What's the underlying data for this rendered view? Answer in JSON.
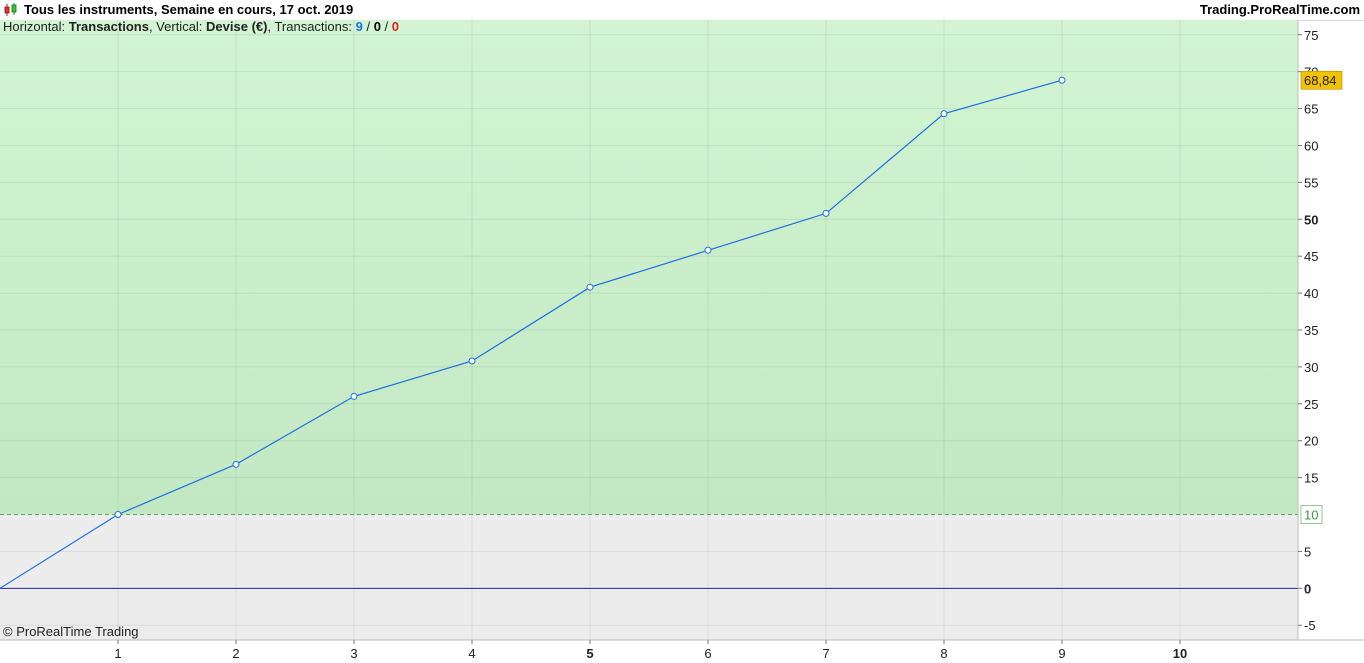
{
  "header": {
    "title": "Tous les instruments, Semaine en cours, 17 oct. 2019",
    "brand": "Trading.ProRealTime.com"
  },
  "legend": {
    "horizontal_label": "Horizontal: ",
    "horizontal_value": "Transactions",
    "vertical_label": ", Vertical: ",
    "vertical_value": "Devise (€)",
    "transactions_label": ", Transactions: ",
    "count_total": "9",
    "sep1": " / ",
    "count_neutral": "0",
    "sep2": " / ",
    "count_losing": "0"
  },
  "footer": {
    "copyright": "© ProRealTime Trading"
  },
  "colors": {
    "line": "#1e6fe6",
    "zero_line": "#1a2aa0",
    "profit_zone_top": "#d2f4d2",
    "profit_zone_bottom": "#c2e8c2",
    "loss_zone": "#ececec",
    "threshold_line": "#6aa46a",
    "last_value_badge": "#f2c200",
    "threshold_badge_text": "#3c9a3c"
  },
  "chart_data": {
    "type": "line",
    "x": [
      0,
      1,
      2,
      3,
      4,
      5,
      6,
      7,
      8,
      9
    ],
    "values": [
      0,
      10,
      16.8,
      26,
      30.8,
      40.8,
      45.8,
      50.8,
      64.3,
      68.84
    ],
    "xlim": [
      0,
      11
    ],
    "ylim": [
      -7,
      77
    ],
    "x_ticks": [
      {
        "value": 1,
        "label": "1",
        "bold": false
      },
      {
        "value": 2,
        "label": "2",
        "bold": false
      },
      {
        "value": 3,
        "label": "3",
        "bold": false
      },
      {
        "value": 4,
        "label": "4",
        "bold": false
      },
      {
        "value": 5,
        "label": "5",
        "bold": true
      },
      {
        "value": 6,
        "label": "6",
        "bold": false
      },
      {
        "value": 7,
        "label": "7",
        "bold": false
      },
      {
        "value": 8,
        "label": "8",
        "bold": false
      },
      {
        "value": 9,
        "label": "9",
        "bold": false
      },
      {
        "value": 10,
        "label": "10",
        "bold": true
      }
    ],
    "y_ticks": [
      {
        "value": -5,
        "label": "-5",
        "bold": false
      },
      {
        "value": 0,
        "label": "0",
        "bold": true
      },
      {
        "value": 5,
        "label": "5",
        "bold": false
      },
      {
        "value": 15,
        "label": "15",
        "bold": false
      },
      {
        "value": 20,
        "label": "20",
        "bold": false
      },
      {
        "value": 25,
        "label": "25",
        "bold": false
      },
      {
        "value": 30,
        "label": "30",
        "bold": false
      },
      {
        "value": 35,
        "label": "35",
        "bold": false
      },
      {
        "value": 40,
        "label": "40",
        "bold": false
      },
      {
        "value": 45,
        "label": "45",
        "bold": false
      },
      {
        "value": 50,
        "label": "50",
        "bold": true
      },
      {
        "value": 55,
        "label": "55",
        "bold": false
      },
      {
        "value": 60,
        "label": "60",
        "bold": false
      },
      {
        "value": 65,
        "label": "65",
        "bold": false
      },
      {
        "value": 70,
        "label": "70",
        "bold": false
      },
      {
        "value": 75,
        "label": "75",
        "bold": false
      }
    ],
    "threshold": {
      "value": 10,
      "label": "10"
    },
    "last_value": {
      "value": 68.84,
      "label": "68,84"
    },
    "grid": true
  }
}
